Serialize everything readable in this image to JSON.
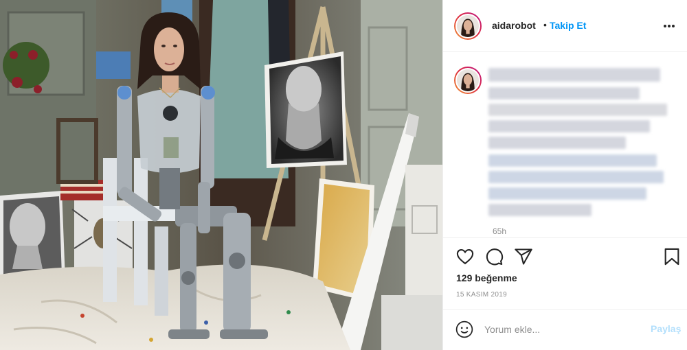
{
  "photo": {
    "alt_icon": "robot-artist-photo"
  },
  "header": {
    "username": "aidarobot",
    "dot": "•",
    "follow_label": "Takip Et",
    "more_icon": "more-options-icon"
  },
  "caption": {
    "time_ago": "65h"
  },
  "actions": {
    "like_icon": "heart-icon",
    "comment_icon": "comment-icon",
    "share_icon": "share-icon",
    "save_icon": "bookmark-icon"
  },
  "likes": "129 beğenme",
  "date": "15 KASIM 2019",
  "comment": {
    "placeholder": "Yorum ekle...",
    "post_label": "Paylaş"
  },
  "colors": {
    "accent": "#0095f6",
    "post_disabled": "#b2dffc",
    "muted": "#8e8e8e"
  }
}
